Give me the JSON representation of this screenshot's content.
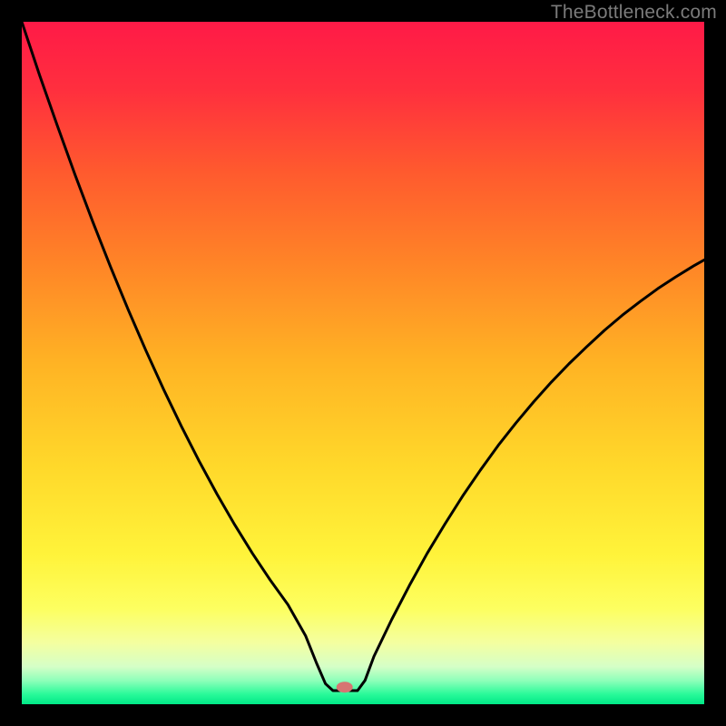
{
  "watermark": "TheBottleneck.com",
  "gradient": {
    "stops": [
      {
        "offset": 0.0,
        "color": "#ff1a47"
      },
      {
        "offset": 0.1,
        "color": "#ff2f3e"
      },
      {
        "offset": 0.22,
        "color": "#ff5a2e"
      },
      {
        "offset": 0.35,
        "color": "#ff8327"
      },
      {
        "offset": 0.5,
        "color": "#ffb324"
      },
      {
        "offset": 0.65,
        "color": "#ffd82a"
      },
      {
        "offset": 0.78,
        "color": "#fff33a"
      },
      {
        "offset": 0.86,
        "color": "#fdff60"
      },
      {
        "offset": 0.91,
        "color": "#f4ffa0"
      },
      {
        "offset": 0.945,
        "color": "#d5ffc7"
      },
      {
        "offset": 0.965,
        "color": "#8fffba"
      },
      {
        "offset": 0.985,
        "color": "#2bfa9a"
      },
      {
        "offset": 1.0,
        "color": "#00e887"
      }
    ]
  },
  "marker": {
    "x_pct": 47.3,
    "y_pct": 97.5,
    "color": "#d77572",
    "rx": 9,
    "ry": 6
  },
  "chart_data": {
    "type": "line",
    "title": "",
    "xlabel": "",
    "ylabel": "",
    "xlim": [
      0,
      100
    ],
    "ylim": [
      0,
      100
    ],
    "note": "Bottleneck-percentage style curve. x is relative position across the plot (0–100). y is distance from the bottom of the plot as a percentage of plot height (0 = bottom/green, 100 = top/red). Values are estimated from pixels.",
    "series": [
      {
        "name": "bottleneck-curve",
        "x": [
          0.0,
          2.6,
          5.2,
          7.8,
          10.4,
          13.0,
          15.6,
          18.2,
          20.8,
          23.4,
          26.0,
          28.6,
          31.2,
          33.8,
          36.4,
          39.0,
          41.6,
          43.2,
          44.5,
          45.6,
          49.2,
          50.3,
          51.6,
          54.2,
          56.8,
          59.4,
          62.0,
          64.6,
          67.2,
          69.8,
          72.4,
          75.0,
          77.6,
          80.2,
          82.8,
          85.4,
          88.0,
          90.6,
          93.2,
          95.8,
          98.4,
          100.0
        ],
        "y": [
          100.0,
          92.2,
          84.8,
          77.6,
          70.7,
          64.1,
          57.8,
          51.8,
          46.1,
          40.7,
          35.6,
          30.8,
          26.3,
          22.1,
          18.2,
          14.6,
          10.0,
          6.0,
          3.0,
          2.0,
          2.0,
          3.5,
          7.0,
          12.4,
          17.4,
          22.1,
          26.4,
          30.5,
          34.3,
          37.9,
          41.2,
          44.3,
          47.2,
          49.9,
          52.4,
          54.8,
          57.0,
          59.0,
          60.9,
          62.6,
          64.2,
          65.1
        ]
      }
    ],
    "marker_point": {
      "x": 47.3,
      "y": 2.5
    }
  }
}
